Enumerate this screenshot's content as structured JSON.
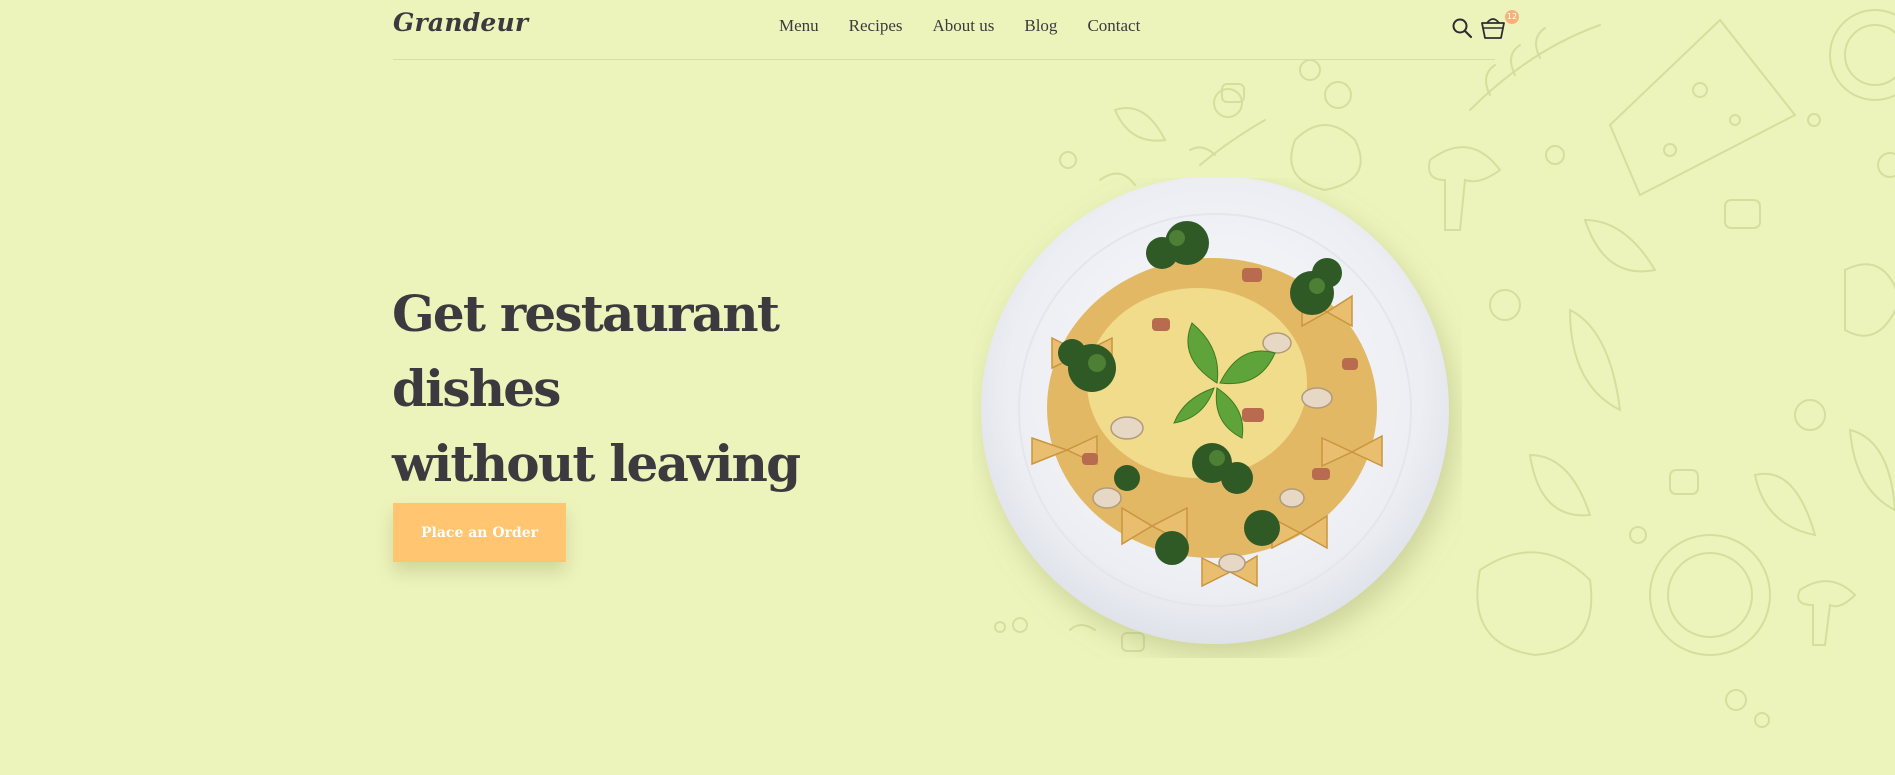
{
  "header": {
    "logo": "Grandeur",
    "nav": [
      "Menu",
      "Recipes",
      "About us",
      "Blog",
      "Contact"
    ],
    "cart_count": "12"
  },
  "hero": {
    "title_line1": "Get restaurant dishes",
    "title_line2": "without leaving home",
    "cta_label": "Place an Order"
  },
  "colors": {
    "background": "#ecf4bb",
    "text": "#3d3a3f",
    "cta": "#ffc570",
    "badge": "#f7b27c"
  },
  "icons": [
    "search-icon",
    "basket-icon"
  ]
}
